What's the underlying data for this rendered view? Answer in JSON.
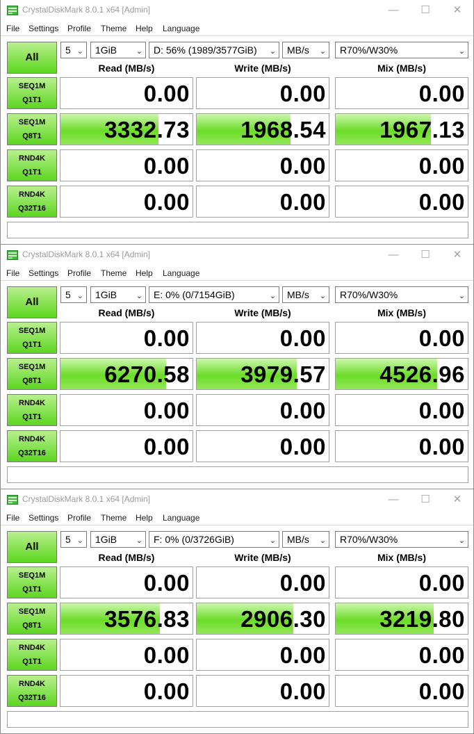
{
  "colors": {
    "accent_green": "#5cd61f",
    "bar_green": "#6bdc28"
  },
  "windows": [
    {
      "title": "CrystalDiskMark 8.0.1 x64 [Admin]",
      "menu": [
        "File",
        "Settings",
        "Profile",
        "Theme",
        "Help",
        "Language"
      ],
      "controls": {
        "all_label": "All",
        "count": "5",
        "size": "1GiB",
        "drive": "D: 56% (1989/3577GiB)",
        "unit": "MB/s",
        "mix": "R70%/W30%"
      },
      "headers": {
        "read": "Read (MB/s)",
        "write": "Write (MB/s)",
        "mix": "Mix (MB/s)"
      },
      "rows": [
        {
          "test_line1": "SEQ1M",
          "test_line2": "Q1T1",
          "read": "0.00",
          "write": "0.00",
          "mix": "0.00",
          "read_fill": 0,
          "write_fill": 0,
          "mix_fill": 0
        },
        {
          "test_line1": "SEQ1M",
          "test_line2": "Q8T1",
          "read": "3332.73",
          "write": "1968.54",
          "mix": "1967.13",
          "read_fill": 0.74,
          "write_fill": 0.71,
          "mix_fill": 0.72
        },
        {
          "test_line1": "RND4K",
          "test_line2": "Q1T1",
          "read": "0.00",
          "write": "0.00",
          "mix": "0.00",
          "read_fill": 0,
          "write_fill": 0,
          "mix_fill": 0
        },
        {
          "test_line1": "RND4K",
          "test_line2": "Q32T16",
          "read": "0.00",
          "write": "0.00",
          "mix": "0.00",
          "read_fill": 0,
          "write_fill": 0,
          "mix_fill": 0
        }
      ],
      "comment": ""
    },
    {
      "title": "CrystalDiskMark 8.0.1 x64 [Admin]",
      "menu": [
        "File",
        "Settings",
        "Profile",
        "Theme",
        "Help",
        "Language"
      ],
      "controls": {
        "all_label": "All",
        "count": "5",
        "size": "1GiB",
        "drive": "E: 0% (0/7154GiB)",
        "unit": "MB/s",
        "mix": "R70%/W30%"
      },
      "headers": {
        "read": "Read (MB/s)",
        "write": "Write (MB/s)",
        "mix": "Mix (MB/s)"
      },
      "rows": [
        {
          "test_line1": "SEQ1M",
          "test_line2": "Q1T1",
          "read": "0.00",
          "write": "0.00",
          "mix": "0.00",
          "read_fill": 0,
          "write_fill": 0,
          "mix_fill": 0
        },
        {
          "test_line1": "SEQ1M",
          "test_line2": "Q8T1",
          "read": "6270.58",
          "write": "3979.57",
          "mix": "4526.96",
          "read_fill": 0.8,
          "write_fill": 0.76,
          "mix_fill": 0.77
        },
        {
          "test_line1": "RND4K",
          "test_line2": "Q1T1",
          "read": "0.00",
          "write": "0.00",
          "mix": "0.00",
          "read_fill": 0,
          "write_fill": 0,
          "mix_fill": 0
        },
        {
          "test_line1": "RND4K",
          "test_line2": "Q32T16",
          "read": "0.00",
          "write": "0.00",
          "mix": "0.00",
          "read_fill": 0,
          "write_fill": 0,
          "mix_fill": 0
        }
      ],
      "comment": ""
    },
    {
      "title": "CrystalDiskMark 8.0.1 x64 [Admin]",
      "menu": [
        "File",
        "Settings",
        "Profile",
        "Theme",
        "Help",
        "Language"
      ],
      "controls": {
        "all_label": "All",
        "count": "5",
        "size": "1GiB",
        "drive": "F: 0% (0/3726GiB)",
        "unit": "MB/s",
        "mix": "R70%/W30%"
      },
      "headers": {
        "read": "Read (MB/s)",
        "write": "Write (MB/s)",
        "mix": "Mix (MB/s)"
      },
      "rows": [
        {
          "test_line1": "SEQ1M",
          "test_line2": "Q1T1",
          "read": "0.00",
          "write": "0.00",
          "mix": "0.00",
          "read_fill": 0,
          "write_fill": 0,
          "mix_fill": 0
        },
        {
          "test_line1": "SEQ1M",
          "test_line2": "Q8T1",
          "read": "3576.83",
          "write": "2906.30",
          "mix": "3219.80",
          "read_fill": 0.75,
          "write_fill": 0.73,
          "mix_fill": 0.74
        },
        {
          "test_line1": "RND4K",
          "test_line2": "Q1T1",
          "read": "0.00",
          "write": "0.00",
          "mix": "0.00",
          "read_fill": 0,
          "write_fill": 0,
          "mix_fill": 0
        },
        {
          "test_line1": "RND4K",
          "test_line2": "Q32T16",
          "read": "0.00",
          "write": "0.00",
          "mix": "0.00",
          "read_fill": 0,
          "write_fill": 0,
          "mix_fill": 0
        }
      ],
      "comment": ""
    }
  ]
}
